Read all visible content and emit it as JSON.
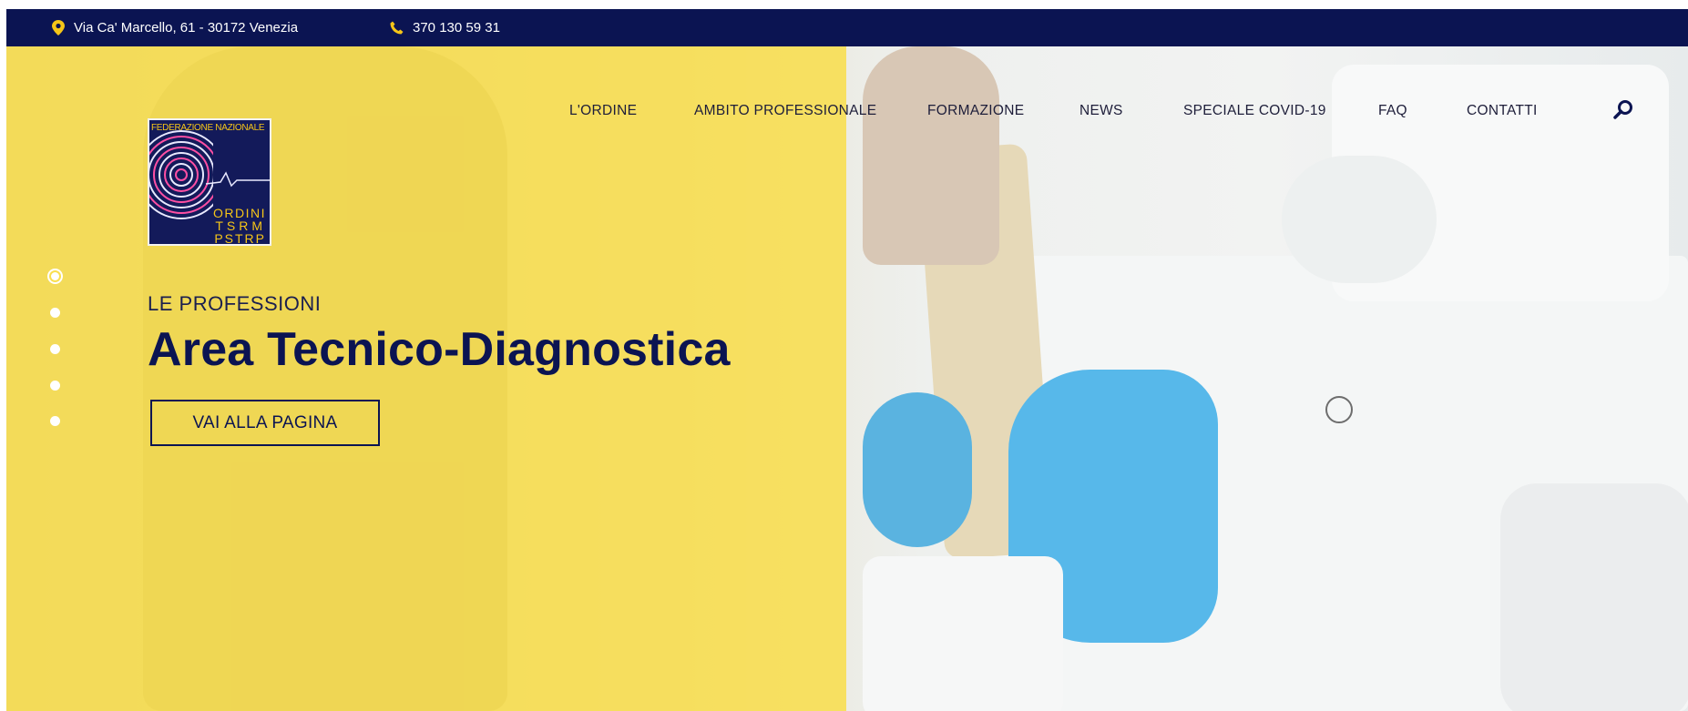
{
  "topbar": {
    "address": "Via Ca' Marcello, 61 - 30172 Venezia",
    "phone": "370 130 59 31"
  },
  "nav": {
    "items": [
      {
        "label": "L'ORDINE"
      },
      {
        "label": "AMBITO PROFESSIONALE"
      },
      {
        "label": "FORMAZIONE"
      },
      {
        "label": "NEWS"
      },
      {
        "label": "SPECIALE COVID-19"
      },
      {
        "label": "FAQ"
      },
      {
        "label": "CONTATTI"
      }
    ],
    "search_icon": "search-icon"
  },
  "logo": {
    "top_text": "FEDERAZIONE NAZIONALE",
    "lines": [
      "ORDINI",
      "TSRM",
      "PSTRP"
    ]
  },
  "slider": {
    "total_slides": 5,
    "active_index": 0
  },
  "hero": {
    "kicker": "LE PROFESSIONI",
    "title": "Area Tecnico-Diagnostica",
    "cta": "VAI ALLA PAGINA"
  },
  "colors": {
    "navy": "#0b1452",
    "yellow_overlay": "#fadc3c",
    "glove_blue": "#57b8ea"
  }
}
